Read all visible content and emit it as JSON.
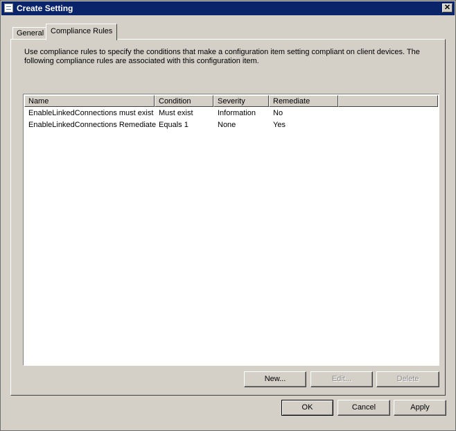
{
  "window": {
    "title": "Create Setting"
  },
  "tabs": [
    {
      "label": "General"
    },
    {
      "label": "Compliance Rules"
    }
  ],
  "intro_text": "Use compliance rules to specify the conditions that make a configuration item setting compliant on client devices. The following compliance rules are associated with this configuration item.",
  "table": {
    "columns": [
      "Name",
      "Condition",
      "Severity",
      "Remediate"
    ],
    "rows": [
      [
        "EnableLinkedConnections must exist",
        "Must exist",
        "Information",
        "No"
      ],
      [
        "EnableLinkedConnections Remediate",
        "Equals 1",
        "None",
        "Yes"
      ]
    ]
  },
  "rule_buttons": {
    "new": "New...",
    "edit": "Edit...",
    "delete": "Delete"
  },
  "dialog_buttons": {
    "ok": "OK",
    "cancel": "Cancel",
    "apply": "Apply"
  },
  "colors": {
    "titlebar": "#0a246a",
    "face": "#d4d0c8"
  }
}
